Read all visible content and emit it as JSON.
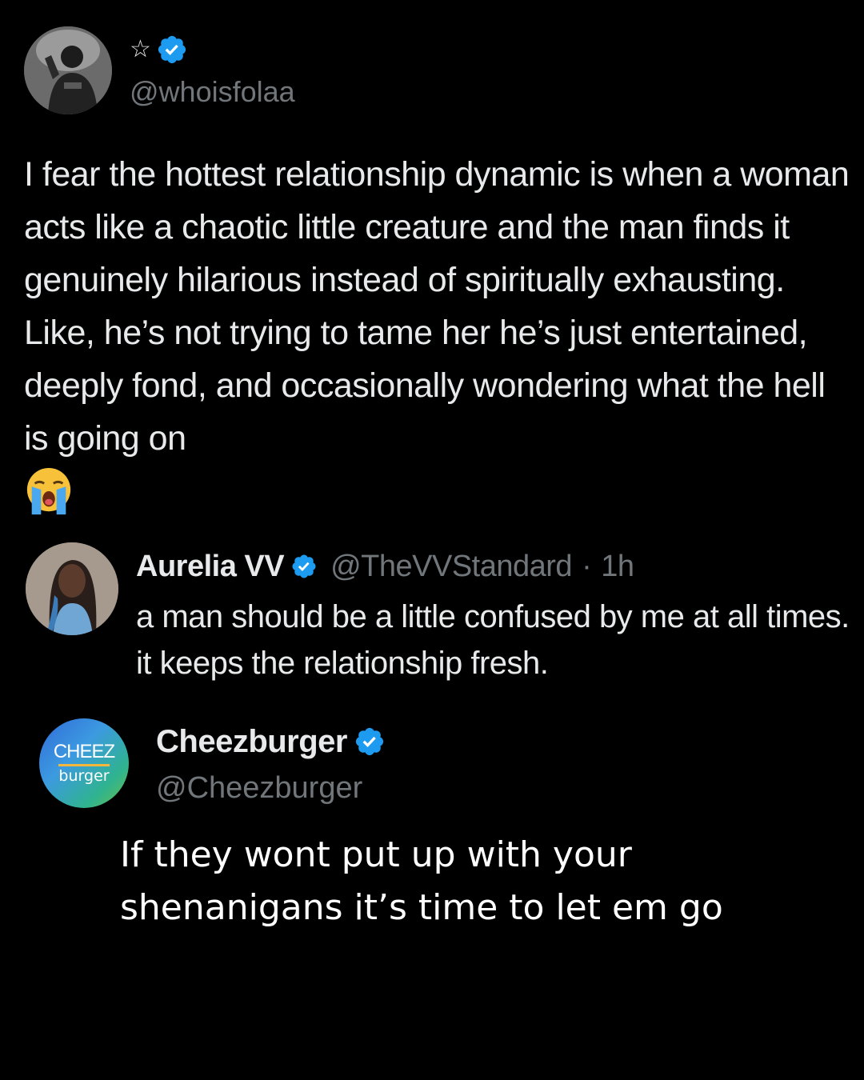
{
  "colors": {
    "background": "#000000",
    "text_primary": "#e7e9ea",
    "text_secondary": "#71767b",
    "verified_blue": "#1d9bf0",
    "cheezburger_gradient": [
      "#2f6bd9",
      "#3c9ae0",
      "#2fb38f",
      "#6cc04a"
    ]
  },
  "tweet1": {
    "avatar_icon": "profile-photo",
    "name_icon": "star-outline-icon",
    "verified": true,
    "handle": "@whoisfolaa",
    "body": "I fear the hottest relationship dynamic is when a woman acts like a chaotic little creature and the man finds it genuinely hilarious instead of spiritually exhausting. Like, he’s not trying to tame her he’s just entertained, deeply fond, and occasionally wondering what the hell is going on",
    "emoji": "loudly-crying-face"
  },
  "tweet2": {
    "avatar_icon": "profile-photo",
    "name": "Aurelia VV",
    "verified": true,
    "handle": "@TheVVStandard",
    "separator": "·",
    "time": "1h",
    "body": "a man should be a little confused by me at all times. it keeps the relationship fresh."
  },
  "tweet3": {
    "logo_top": "CHEEZ",
    "logo_bottom": "burger",
    "name": "Cheezburger",
    "verified": true,
    "handle": "@Cheezburger",
    "body": "If they wont put up with your shenanigans it’s time to let em go"
  }
}
